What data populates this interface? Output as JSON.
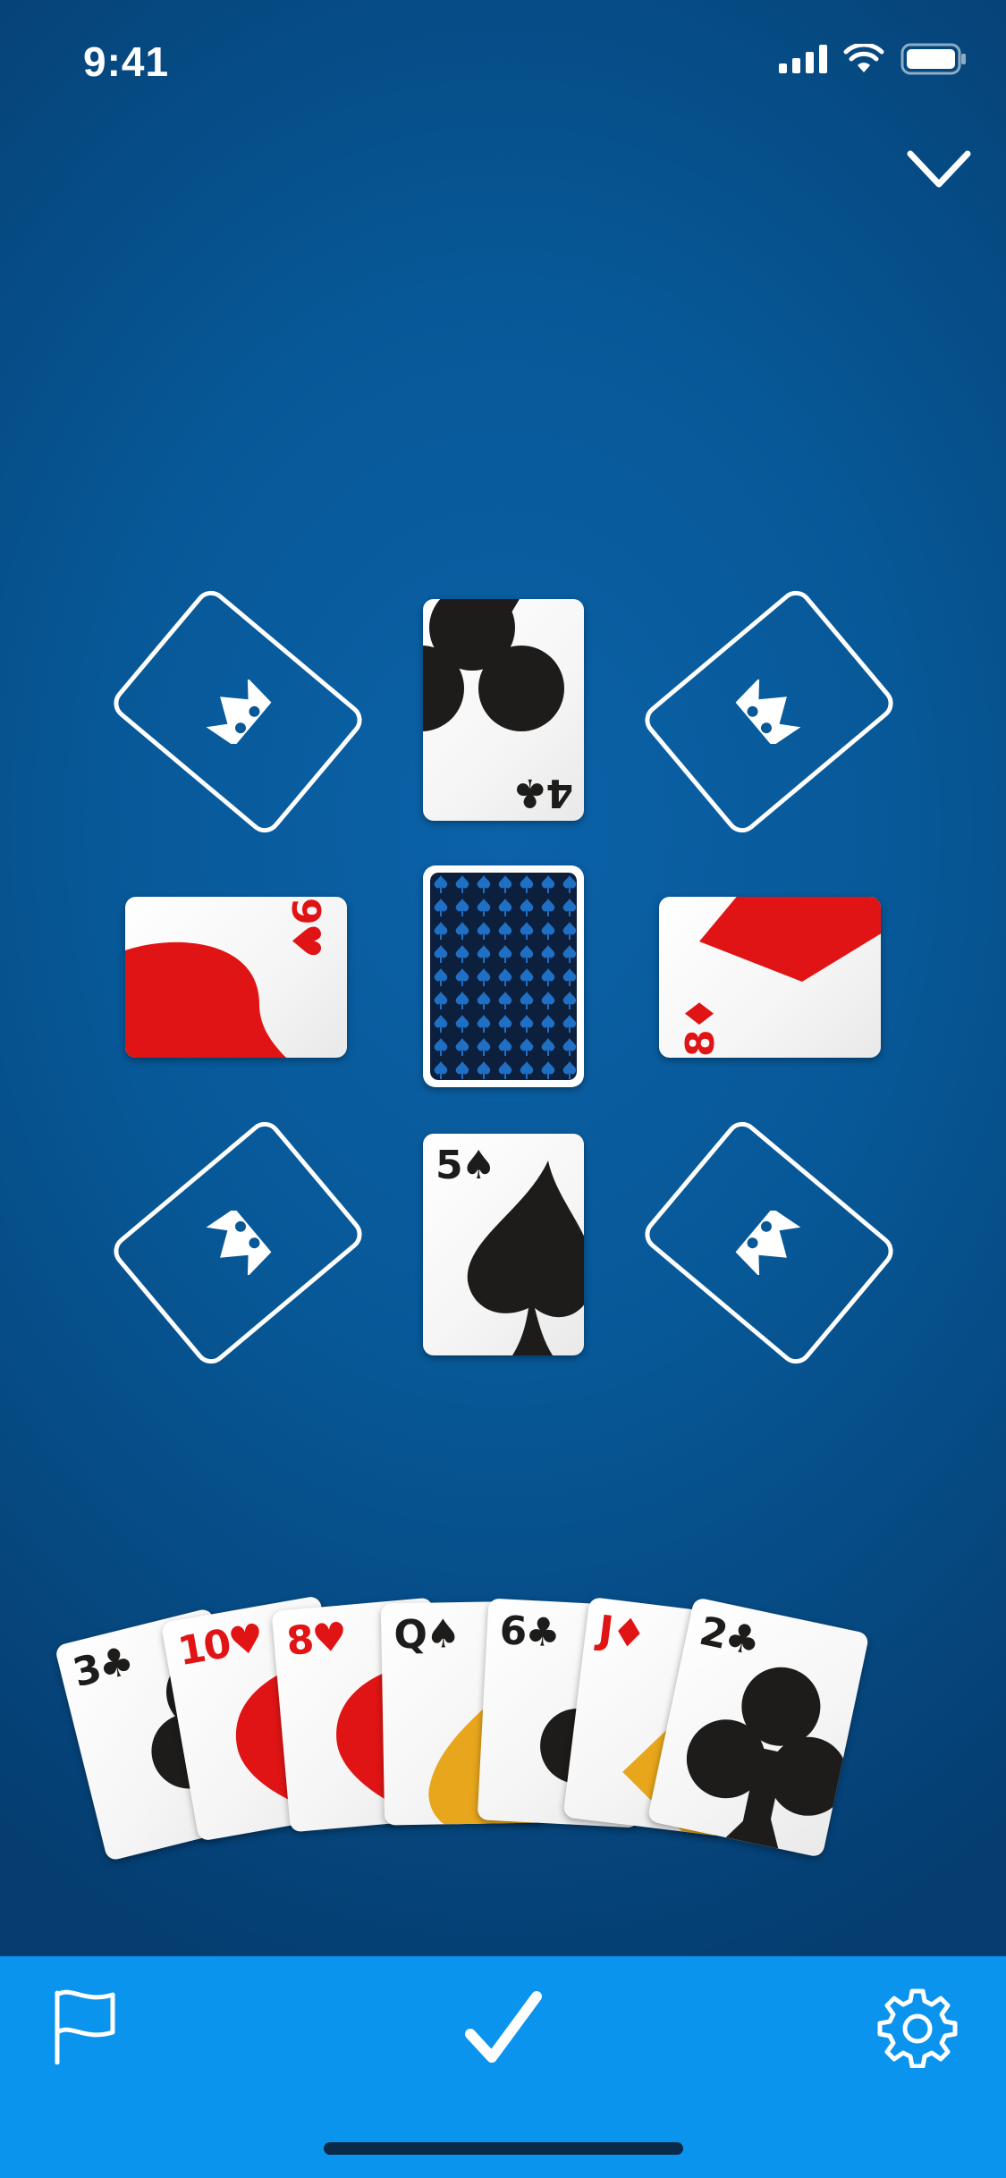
{
  "status_bar": {
    "time": "9:41",
    "icons": [
      "signal-icon",
      "wifi-icon",
      "battery-icon"
    ]
  },
  "header": {
    "collapse_icon": "chevron-down-icon"
  },
  "board": {
    "foundations": [
      {
        "position": "top-left",
        "icon": "crown-icon"
      },
      {
        "position": "top-right",
        "icon": "crown-icon"
      },
      {
        "position": "bottom-left",
        "icon": "crown-icon"
      },
      {
        "position": "bottom-right",
        "icon": "crown-icon"
      }
    ],
    "piles": {
      "top": {
        "rank": "4",
        "suit": "clubs",
        "suit_symbol": "♣",
        "color": "black",
        "rotation": "180"
      },
      "left": {
        "rank": "9",
        "suit": "hearts",
        "suit_symbol": "♥",
        "color": "red",
        "rotation": "90"
      },
      "right": {
        "rank": "8",
        "suit": "diamonds",
        "suit_symbol": "♦",
        "color": "red",
        "rotation": "-90"
      },
      "bottom": {
        "rank": "5",
        "suit": "spades",
        "suit_symbol": "♠",
        "color": "black",
        "rotation": "0"
      }
    },
    "stock": {
      "face": "down",
      "pattern_color": "#1f6fc4"
    }
  },
  "hand": {
    "cards": [
      {
        "rank": "3",
        "suit_symbol": "♣",
        "suit": "clubs",
        "color": "black"
      },
      {
        "rank": "10",
        "suit_symbol": "♥",
        "suit": "hearts",
        "color": "red"
      },
      {
        "rank": "8",
        "suit_symbol": "♥",
        "suit": "hearts",
        "color": "red"
      },
      {
        "rank": "Q",
        "suit_symbol": "♠",
        "suit": "spades",
        "color": "black"
      },
      {
        "rank": "6",
        "suit_symbol": "♣",
        "suit": "clubs",
        "color": "black"
      },
      {
        "rank": "J",
        "suit_symbol": "♦",
        "suit": "diamonds",
        "color": "red"
      },
      {
        "rank": "2",
        "suit_symbol": "♣",
        "suit": "clubs",
        "color": "black"
      }
    ]
  },
  "toolbar": {
    "left_icon": "flag-icon",
    "center_icon": "checkmark-icon",
    "right_icon": "gear-icon",
    "background": "#0a94ee"
  },
  "colors": {
    "black_suit": "#1e1c1a",
    "red_suit": "#e01414",
    "court_gold": "#e8a61c",
    "felt": "#075897"
  }
}
